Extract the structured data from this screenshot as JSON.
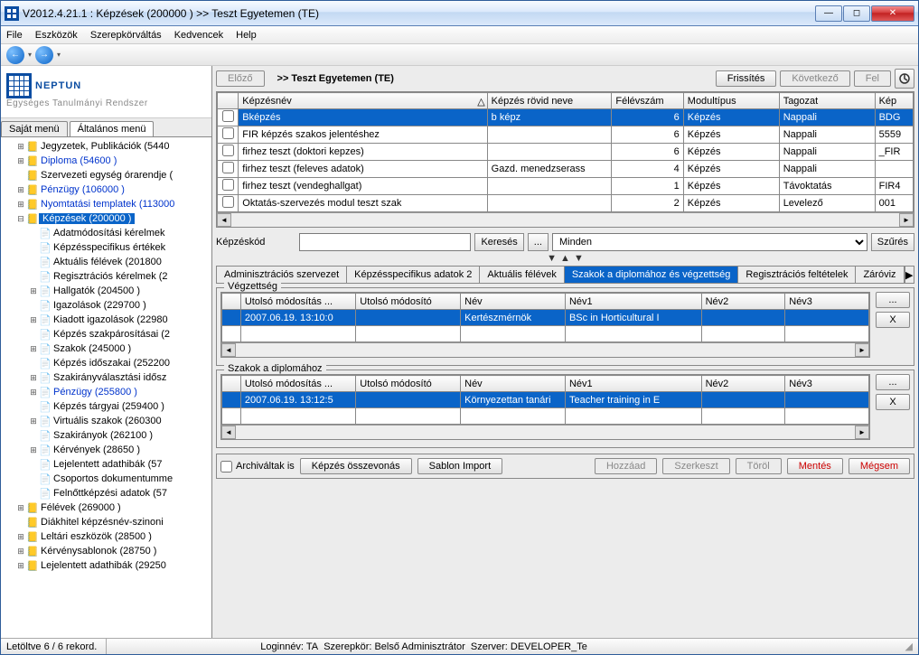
{
  "window": {
    "title": "V2012.4.21.1 : Képzések (200000  )  >> Teszt Egyetemen (TE)"
  },
  "menu": [
    "File",
    "Eszközök",
    "Szerepkörváltás",
    "Kedvencek",
    "Help"
  ],
  "logo": {
    "main": "NEPTUN",
    "sub": "Egységes Tanulmányi Rendszer"
  },
  "side_tabs": {
    "a": "Saját menü",
    "b": "Általános menü"
  },
  "tree": [
    {
      "indent": 1,
      "exp": "+",
      "icon": "📒",
      "label": "Jegyzetek, Publikációk (5440",
      "blue": false
    },
    {
      "indent": 1,
      "exp": "+",
      "icon": "📒",
      "label": "Diploma (54600  )",
      "blue": true
    },
    {
      "indent": 1,
      "exp": "",
      "icon": "📒",
      "label": "Szervezeti egység órarendje (",
      "blue": false
    },
    {
      "indent": 1,
      "exp": "+",
      "icon": "📒",
      "label": "Pénzügy (106000  )",
      "blue": true
    },
    {
      "indent": 1,
      "exp": "+",
      "icon": "📒",
      "label": "Nyomtatási templatek (113000",
      "blue": true
    },
    {
      "indent": 1,
      "exp": "−",
      "icon": "📒",
      "label": "Képzések  (200000  )",
      "blue": true,
      "selected": true
    },
    {
      "indent": 2,
      "exp": "",
      "icon": "📄",
      "label": "Adatmódosítási kérelmek",
      "blue": false
    },
    {
      "indent": 2,
      "exp": "",
      "icon": "📄",
      "label": "Képzésspecifikus értékek",
      "blue": false
    },
    {
      "indent": 2,
      "exp": "",
      "icon": "📄",
      "label": "Aktuális félévek (201800",
      "blue": false
    },
    {
      "indent": 2,
      "exp": "",
      "icon": "📄",
      "label": "Regisztrációs kérelmek (2",
      "blue": false
    },
    {
      "indent": 2,
      "exp": "+",
      "icon": "📄",
      "label": "Hallgatók (204500  )",
      "blue": false
    },
    {
      "indent": 2,
      "exp": "",
      "icon": "📄",
      "label": "Igazolások (229700  )",
      "blue": false
    },
    {
      "indent": 2,
      "exp": "+",
      "icon": "📄",
      "label": "Kiadott igazolások (22980",
      "blue": false
    },
    {
      "indent": 2,
      "exp": "",
      "icon": "📄",
      "label": "Képzés szakpárosításai (2",
      "blue": false
    },
    {
      "indent": 2,
      "exp": "+",
      "icon": "📄",
      "label": "Szakok (245000  )",
      "blue": false
    },
    {
      "indent": 2,
      "exp": "",
      "icon": "📄",
      "label": "Képzés időszakai (252200",
      "blue": false
    },
    {
      "indent": 2,
      "exp": "+",
      "icon": "📄",
      "label": "Szakirányválasztási idősz",
      "blue": false
    },
    {
      "indent": 2,
      "exp": "+",
      "icon": "📄",
      "label": "Pénzügy (255800  )",
      "blue": true
    },
    {
      "indent": 2,
      "exp": "",
      "icon": "📄",
      "label": "Képzés tárgyai (259400  )",
      "blue": false
    },
    {
      "indent": 2,
      "exp": "+",
      "icon": "📄",
      "label": "Virtuális szakok (260300",
      "blue": false
    },
    {
      "indent": 2,
      "exp": "",
      "icon": "📄",
      "label": "Szakirányok (262100  )",
      "blue": false
    },
    {
      "indent": 2,
      "exp": "+",
      "icon": "📄",
      "label": "Kérvények (28650  )",
      "blue": false
    },
    {
      "indent": 2,
      "exp": "",
      "icon": "📄",
      "label": "Lejelentett adathibák (57",
      "blue": false
    },
    {
      "indent": 2,
      "exp": "",
      "icon": "📄",
      "label": "Csoportos dokumentumme",
      "blue": false
    },
    {
      "indent": 2,
      "exp": "",
      "icon": "📄",
      "label": "Felnőttképzési adatok (57",
      "blue": false
    },
    {
      "indent": 1,
      "exp": "+",
      "icon": "📒",
      "label": "Félévek (269000  )",
      "blue": false
    },
    {
      "indent": 1,
      "exp": "",
      "icon": "📒",
      "label": "Diákhitel képzésnév-szinoni",
      "blue": false
    },
    {
      "indent": 1,
      "exp": "+",
      "icon": "📒",
      "label": "Leltári eszközök (28500  )",
      "blue": false
    },
    {
      "indent": 1,
      "exp": "+",
      "icon": "📒",
      "label": "Kérvénysablonok (28750  )",
      "blue": false
    },
    {
      "indent": 1,
      "exp": "+",
      "icon": "📒",
      "label": "Lejelentett adathibák (29250",
      "blue": false
    }
  ],
  "rp": {
    "prev": "Előző",
    "title": ">>  Teszt Egyetemen (TE)",
    "refresh": "Frissítés",
    "next": "Következő",
    "up": "Fel"
  },
  "grid": {
    "cols": [
      "",
      "Képzésnév",
      "Képzés rövid neve",
      "Félévszám",
      "Modultípus",
      "Tagozat",
      "Kép"
    ],
    "rows": [
      {
        "sel": true,
        "c": [
          "Bképzés",
          "b képz",
          "6",
          "Képzés",
          "Nappali",
          "BDG"
        ]
      },
      {
        "sel": false,
        "c": [
          "FIR képzés szakos jelentéshez",
          "",
          "6",
          "Képzés",
          "Nappali",
          "5559"
        ]
      },
      {
        "sel": false,
        "c": [
          "firhez teszt (doktori kepzes)",
          "",
          "6",
          "Képzés",
          "Nappali",
          "_FIR"
        ]
      },
      {
        "sel": false,
        "c": [
          "firhez teszt (feleves adatok)",
          "Gazd. menedzserass",
          "4",
          "Képzés",
          "Nappali",
          ""
        ]
      },
      {
        "sel": false,
        "c": [
          "firhez teszt (vendeghallgat)",
          "",
          "1",
          "Képzés",
          "Távoktatás",
          "FIR4"
        ]
      },
      {
        "sel": false,
        "c": [
          "Oktatás-szervezés modul teszt szak",
          "",
          "2",
          "Képzés",
          "Levelező",
          "001"
        ]
      }
    ]
  },
  "search": {
    "label": "Képzéskód",
    "search": "Keresés",
    "all": "Minden",
    "filter": "Szűrés",
    "ellipsis": "..."
  },
  "subtabs": [
    "Adminisztrációs szervezet",
    "Képzésspecifikus adatok 2",
    "Aktuális félévek",
    "Szakok a diplomához és végzettség",
    "Regisztrációs feltételek",
    "Záróviz"
  ],
  "subtab_active": 3,
  "sec1": {
    "title": "Végzettség",
    "cols": [
      "",
      "Utolsó módosítás ...",
      "Utolsó módosító",
      "Név",
      "Név1",
      "Név2",
      "Név3"
    ],
    "row": [
      "",
      "2007.06.19. 13:10:0",
      "",
      "Kertészmérnök",
      "BSc in Horticultural I",
      "",
      ""
    ],
    "btn_more": "...",
    "btn_x": "X"
  },
  "sec2": {
    "title": "Szakok a diplomához",
    "cols": [
      "",
      "Utolsó módosítás ...",
      "Utolsó módosító",
      "Név",
      "Név1",
      "Név2",
      "Név3"
    ],
    "row": [
      "",
      "2007.06.19. 13:12:5",
      "",
      "Környezettan tanári",
      "Teacher training in E",
      "",
      ""
    ],
    "btn_more": "...",
    "btn_x": "X"
  },
  "bottom": {
    "archive": "Archiváltak is",
    "merge": "Képzés összevonás",
    "import": "Sablon Import",
    "add": "Hozzáad",
    "edit": "Szerkeszt",
    "del": "Töröl",
    "save": "Mentés",
    "cancel": "Mégsem"
  },
  "status": {
    "records": "Letöltve 6 / 6 rekord.",
    "login": "Loginnév: TA",
    "role": "Szerepkör: Belső Adminisztrátor",
    "server": "Szerver: DEVELOPER_Te"
  }
}
